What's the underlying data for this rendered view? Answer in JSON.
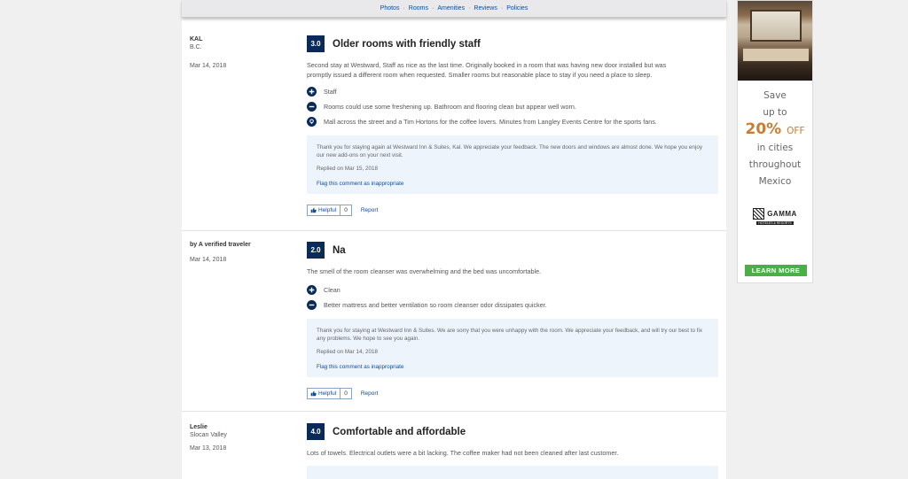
{
  "nav": {
    "items": [
      "Photos",
      "Rooms",
      "Amenities",
      "Reviews",
      "Policies"
    ]
  },
  "reviews": [
    {
      "author": "KAL",
      "location": "B.C.",
      "date": "Mar 14, 2018",
      "score": "3.0",
      "title": "Older rooms with friendly staff",
      "text": "Second stay at Westward, Staff as nice as the last time. Originally booked in a room that was having new door installed but was promptly issued a different room when requested. Smaller rooms but reasonable place to stay if you need a place to sleep.",
      "points": [
        {
          "icon": "plus-icon",
          "text": "Staff"
        },
        {
          "icon": "minus-icon",
          "text": "Rooms could use some freshening up. Bathroom and flooring clean but appear well worn."
        },
        {
          "icon": "location-pin-icon",
          "text": "Mall across the street and a Tim Hortons for the coffee lovers. Minutes from Langley Events Centre for the sports fans."
        }
      ],
      "reply": {
        "text": "Thank you for staying again at Westward Inn & Suites, Kal. We appreciate your feedback. The new doors and windows are almost done. We hope you enjoy our new add-ons on your next visit.",
        "date": "Replied on Mar 15, 2018",
        "flag": "Flag this comment as inappropriate"
      },
      "helpful_label": "Helpful",
      "helpful_count": "0",
      "report_label": "Report"
    },
    {
      "author": "by A verified traveler",
      "location": "",
      "date": "Mar 14, 2018",
      "score": "2.0",
      "title": "Na",
      "text": "The smell of the room cleanser was overwhelming and the bed was uncomfortable.",
      "points": [
        {
          "icon": "plus-icon",
          "text": "Clean"
        },
        {
          "icon": "minus-icon",
          "text": "Better mattress and better ventilation so room cleanser odor dissipates quicker."
        }
      ],
      "reply": {
        "text": "Thank you for staying at Westward Inn & Suites. We are sorry that you were unhappy with the room. We appreciate your feedback, and will try our best to fix any problems. We hope to see you again.",
        "date": "Replied on Mar 14, 2018",
        "flag": "Flag this comment as inappropriate"
      },
      "helpful_label": "Helpful",
      "helpful_count": "0",
      "report_label": "Report"
    },
    {
      "author": "Leslie",
      "location": "Slocan Valley",
      "date": "Mar 13, 2018",
      "score": "4.0",
      "title": "Comfortable and affordable",
      "text": "Lots of towels. Electrical outlets were a bit lacking. The coffee maker had not been cleaned after last customer."
    }
  ],
  "ad": {
    "line1": "Save",
    "line2": "up to",
    "percent": "20%",
    "off": "OFF",
    "line3": "in cities",
    "line4": "throughout",
    "line5": "Mexico",
    "logo_name": "GAMMA",
    "logo_sub": "HOTELES & RESORTS",
    "cta": "LEARN MORE"
  }
}
